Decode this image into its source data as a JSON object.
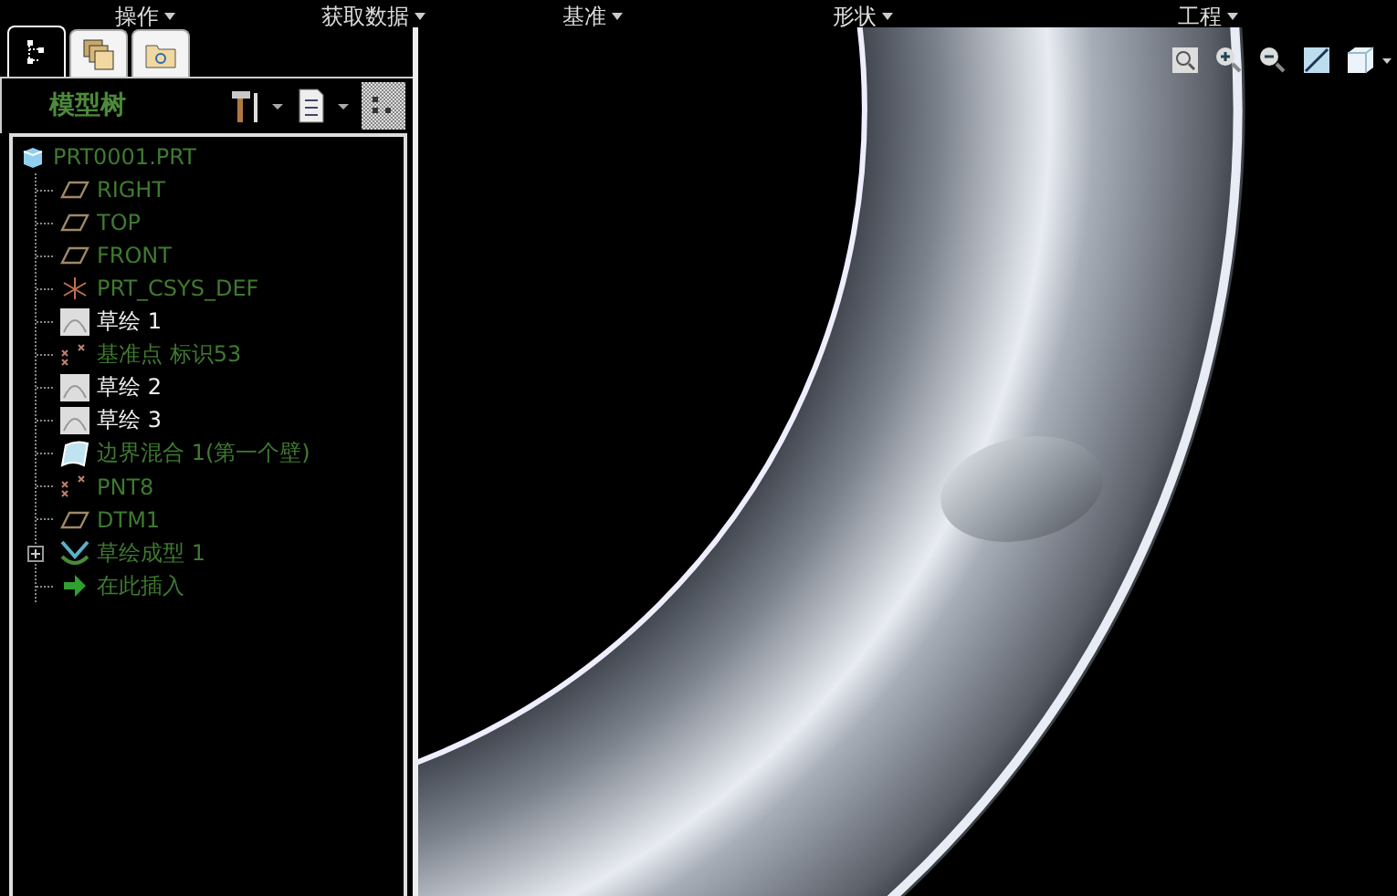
{
  "menu": [
    {
      "label": "操作"
    },
    {
      "label": "获取数据"
    },
    {
      "label": "基准"
    },
    {
      "label": "形状"
    },
    {
      "label": "工程"
    }
  ],
  "tabs": [
    {
      "kind": "tree",
      "selected": true
    },
    {
      "kind": "layers",
      "selected": false
    },
    {
      "kind": "folder",
      "selected": false
    }
  ],
  "panel_title": "模型树",
  "tree": {
    "root": "PRT0001.PRT",
    "items": [
      {
        "kind": "plane",
        "label": "RIGHT",
        "collapsed": false
      },
      {
        "kind": "plane",
        "label": "TOP",
        "collapsed": false
      },
      {
        "kind": "plane",
        "label": "FRONT",
        "collapsed": false
      },
      {
        "kind": "csys",
        "label": "PRT_CSYS_DEF",
        "collapsed": false
      },
      {
        "kind": "sketch",
        "label": "草绘 1",
        "collapsed": false
      },
      {
        "kind": "point",
        "label": "基准点 标识53",
        "collapsed": false
      },
      {
        "kind": "sketch",
        "label": "草绘 2",
        "collapsed": false
      },
      {
        "kind": "sketch",
        "label": "草绘 3",
        "collapsed": false
      },
      {
        "kind": "surface",
        "label": "边界混合 1(第一个壁)",
        "collapsed": false
      },
      {
        "kind": "point",
        "label": "PNT8",
        "collapsed": false
      },
      {
        "kind": "plane",
        "label": "DTM1",
        "collapsed": false
      },
      {
        "kind": "feature",
        "label": "草绘成型 1",
        "collapsed": true
      },
      {
        "kind": "insert",
        "label": "在此插入",
        "collapsed": false
      }
    ]
  }
}
